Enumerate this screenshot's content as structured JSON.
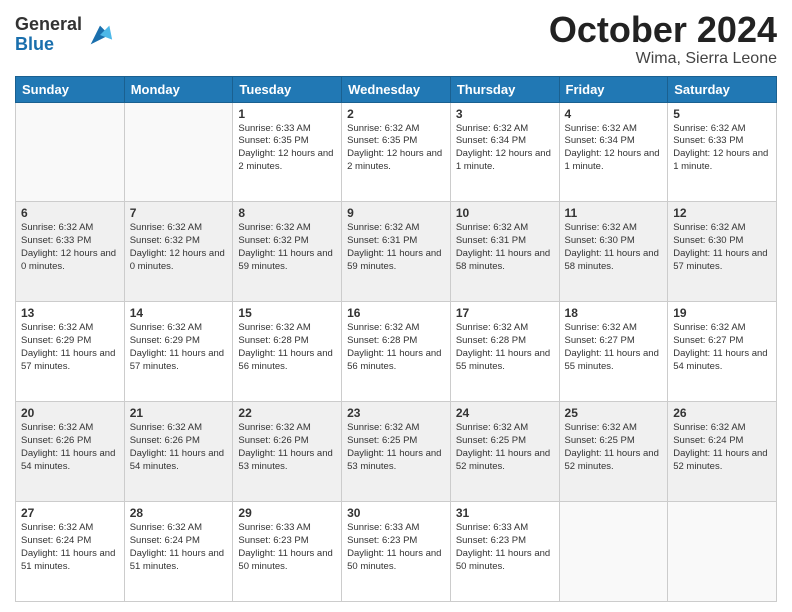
{
  "logo": {
    "general": "General",
    "blue": "Blue"
  },
  "title": "October 2024",
  "subtitle": "Wima, Sierra Leone",
  "days_of_week": [
    "Sunday",
    "Monday",
    "Tuesday",
    "Wednesday",
    "Thursday",
    "Friday",
    "Saturday"
  ],
  "weeks": [
    [
      {
        "day": "",
        "info": ""
      },
      {
        "day": "",
        "info": ""
      },
      {
        "day": "1",
        "info": "Sunrise: 6:33 AM\nSunset: 6:35 PM\nDaylight: 12 hours\nand 2 minutes."
      },
      {
        "day": "2",
        "info": "Sunrise: 6:32 AM\nSunset: 6:35 PM\nDaylight: 12 hours\nand 2 minutes."
      },
      {
        "day": "3",
        "info": "Sunrise: 6:32 AM\nSunset: 6:34 PM\nDaylight: 12 hours\nand 1 minute."
      },
      {
        "day": "4",
        "info": "Sunrise: 6:32 AM\nSunset: 6:34 PM\nDaylight: 12 hours\nand 1 minute."
      },
      {
        "day": "5",
        "info": "Sunrise: 6:32 AM\nSunset: 6:33 PM\nDaylight: 12 hours\nand 1 minute."
      }
    ],
    [
      {
        "day": "6",
        "info": "Sunrise: 6:32 AM\nSunset: 6:33 PM\nDaylight: 12 hours\nand 0 minutes."
      },
      {
        "day": "7",
        "info": "Sunrise: 6:32 AM\nSunset: 6:32 PM\nDaylight: 12 hours\nand 0 minutes."
      },
      {
        "day": "8",
        "info": "Sunrise: 6:32 AM\nSunset: 6:32 PM\nDaylight: 11 hours\nand 59 minutes."
      },
      {
        "day": "9",
        "info": "Sunrise: 6:32 AM\nSunset: 6:31 PM\nDaylight: 11 hours\nand 59 minutes."
      },
      {
        "day": "10",
        "info": "Sunrise: 6:32 AM\nSunset: 6:31 PM\nDaylight: 11 hours\nand 58 minutes."
      },
      {
        "day": "11",
        "info": "Sunrise: 6:32 AM\nSunset: 6:30 PM\nDaylight: 11 hours\nand 58 minutes."
      },
      {
        "day": "12",
        "info": "Sunrise: 6:32 AM\nSunset: 6:30 PM\nDaylight: 11 hours\nand 57 minutes."
      }
    ],
    [
      {
        "day": "13",
        "info": "Sunrise: 6:32 AM\nSunset: 6:29 PM\nDaylight: 11 hours\nand 57 minutes."
      },
      {
        "day": "14",
        "info": "Sunrise: 6:32 AM\nSunset: 6:29 PM\nDaylight: 11 hours\nand 57 minutes."
      },
      {
        "day": "15",
        "info": "Sunrise: 6:32 AM\nSunset: 6:28 PM\nDaylight: 11 hours\nand 56 minutes."
      },
      {
        "day": "16",
        "info": "Sunrise: 6:32 AM\nSunset: 6:28 PM\nDaylight: 11 hours\nand 56 minutes."
      },
      {
        "day": "17",
        "info": "Sunrise: 6:32 AM\nSunset: 6:28 PM\nDaylight: 11 hours\nand 55 minutes."
      },
      {
        "day": "18",
        "info": "Sunrise: 6:32 AM\nSunset: 6:27 PM\nDaylight: 11 hours\nand 55 minutes."
      },
      {
        "day": "19",
        "info": "Sunrise: 6:32 AM\nSunset: 6:27 PM\nDaylight: 11 hours\nand 54 minutes."
      }
    ],
    [
      {
        "day": "20",
        "info": "Sunrise: 6:32 AM\nSunset: 6:26 PM\nDaylight: 11 hours\nand 54 minutes."
      },
      {
        "day": "21",
        "info": "Sunrise: 6:32 AM\nSunset: 6:26 PM\nDaylight: 11 hours\nand 54 minutes."
      },
      {
        "day": "22",
        "info": "Sunrise: 6:32 AM\nSunset: 6:26 PM\nDaylight: 11 hours\nand 53 minutes."
      },
      {
        "day": "23",
        "info": "Sunrise: 6:32 AM\nSunset: 6:25 PM\nDaylight: 11 hours\nand 53 minutes."
      },
      {
        "day": "24",
        "info": "Sunrise: 6:32 AM\nSunset: 6:25 PM\nDaylight: 11 hours\nand 52 minutes."
      },
      {
        "day": "25",
        "info": "Sunrise: 6:32 AM\nSunset: 6:25 PM\nDaylight: 11 hours\nand 52 minutes."
      },
      {
        "day": "26",
        "info": "Sunrise: 6:32 AM\nSunset: 6:24 PM\nDaylight: 11 hours\nand 52 minutes."
      }
    ],
    [
      {
        "day": "27",
        "info": "Sunrise: 6:32 AM\nSunset: 6:24 PM\nDaylight: 11 hours\nand 51 minutes."
      },
      {
        "day": "28",
        "info": "Sunrise: 6:32 AM\nSunset: 6:24 PM\nDaylight: 11 hours\nand 51 minutes."
      },
      {
        "day": "29",
        "info": "Sunrise: 6:33 AM\nSunset: 6:23 PM\nDaylight: 11 hours\nand 50 minutes."
      },
      {
        "day": "30",
        "info": "Sunrise: 6:33 AM\nSunset: 6:23 PM\nDaylight: 11 hours\nand 50 minutes."
      },
      {
        "day": "31",
        "info": "Sunrise: 6:33 AM\nSunset: 6:23 PM\nDaylight: 11 hours\nand 50 minutes."
      },
      {
        "day": "",
        "info": ""
      },
      {
        "day": "",
        "info": ""
      }
    ]
  ]
}
